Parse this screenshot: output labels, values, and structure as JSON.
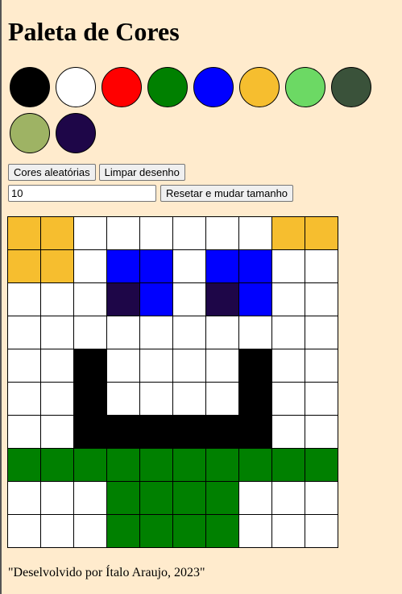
{
  "title": "Paleta de Cores",
  "palette": [
    {
      "color": "#000000"
    },
    {
      "color": "#FFFFFF"
    },
    {
      "color": "#FF0000"
    },
    {
      "color": "#008000"
    },
    {
      "color": "#0000FF"
    },
    {
      "color": "#F6BE2F"
    },
    {
      "color": "#6CD964"
    },
    {
      "color": "#3A523A"
    },
    {
      "color": "#9EB364"
    },
    {
      "color": "#1E0648"
    }
  ],
  "buttons": {
    "random_colors": "Cores aleatórias",
    "clear_board": "Limpar desenho",
    "resize": "Resetar e mudar tamanho"
  },
  "board_size_input": {
    "value": "10"
  },
  "board": {
    "colors": {
      "W": "#FFFFFF",
      "Y": "#F6BE2F",
      "B": "#0000FF",
      "D": "#1E0648",
      "K": "#000000",
      "G": "#008000"
    },
    "rows": [
      "YYWWWWWWYY",
      "YYWBBWBBWW",
      "WWWDBWDBWW",
      "WWWWWWWWWW",
      "WWKWWWWKWW",
      "WWKWWWWKWW",
      "WWKKKKKKWW",
      "GGGGGGGGGG",
      "WWWGGGGWWW",
      "WWWGGGGWWW"
    ]
  },
  "footer": "\"Deselvolvido por Ítalo Araujo, 2023\""
}
